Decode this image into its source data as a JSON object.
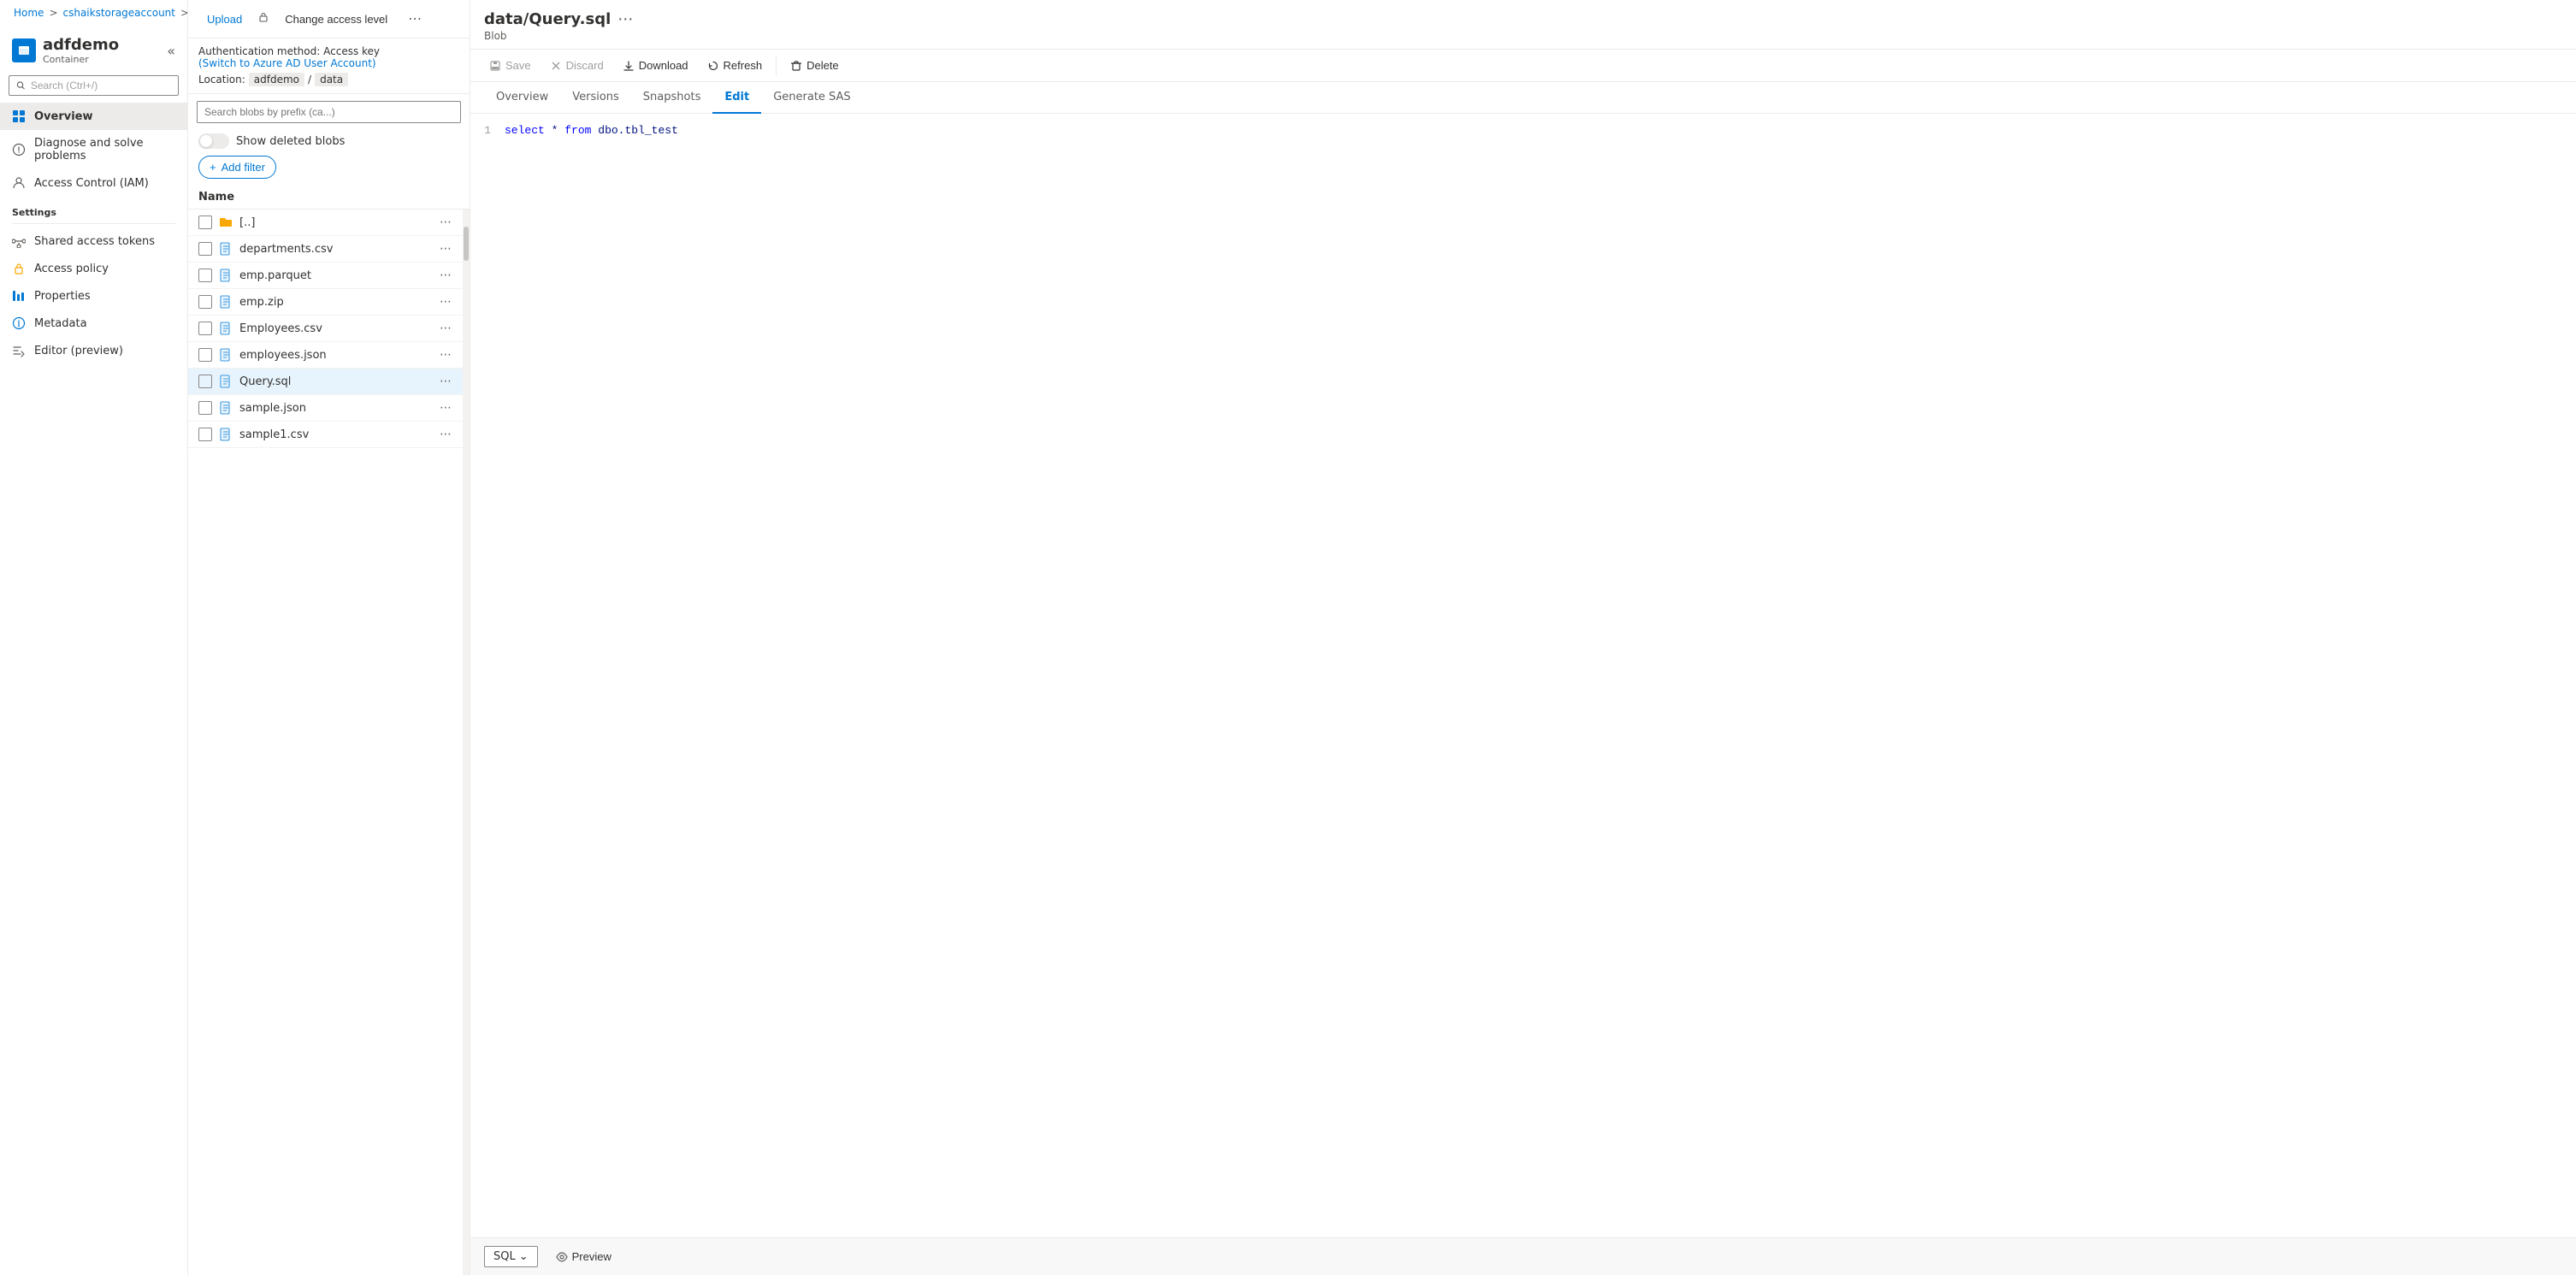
{
  "breadcrumb": {
    "home": "Home",
    "storage": "cshaikstorageaccount",
    "container": "adfdemo"
  },
  "sidebar": {
    "title": "adfdemo",
    "subtitle": "Container",
    "search_placeholder": "Search (Ctrl+/)",
    "collapse_title": "Collapse",
    "nav_items": [
      {
        "id": "overview",
        "label": "Overview",
        "active": true
      },
      {
        "id": "diagnose",
        "label": "Diagnose and solve problems",
        "active": false
      },
      {
        "id": "access-control",
        "label": "Access Control (IAM)",
        "active": false
      }
    ],
    "settings_label": "Settings",
    "settings_items": [
      {
        "id": "shared-access",
        "label": "Shared access tokens"
      },
      {
        "id": "access-policy",
        "label": "Access policy"
      },
      {
        "id": "properties",
        "label": "Properties"
      },
      {
        "id": "metadata",
        "label": "Metadata"
      },
      {
        "id": "editor",
        "label": "Editor (preview)"
      }
    ]
  },
  "file_panel": {
    "upload_label": "Upload",
    "change_access_label": "Change access level",
    "more_options": "...",
    "auth_label": "Authentication method:",
    "auth_value": "Access key",
    "auth_switch_link": "(Switch to Azure AD User Account)",
    "location_label": "Location:",
    "location_parts": [
      "adfdemo",
      "data"
    ],
    "search_placeholder": "Search blobs by prefix (ca...)",
    "show_deleted_label": "Show deleted blobs",
    "add_filter_label": "Add filter",
    "name_column": "Name",
    "files": [
      {
        "id": "folder-up",
        "name": "[..]",
        "type": "folder",
        "selected": false
      },
      {
        "id": "departments",
        "name": "departments.csv",
        "type": "file",
        "selected": false
      },
      {
        "id": "emp-parquet",
        "name": "emp.parquet",
        "type": "file",
        "selected": false
      },
      {
        "id": "emp-zip",
        "name": "emp.zip",
        "type": "file",
        "selected": false
      },
      {
        "id": "employees-csv",
        "name": "Employees.csv",
        "type": "file",
        "selected": false
      },
      {
        "id": "employees-json",
        "name": "employees.json",
        "type": "file",
        "selected": false
      },
      {
        "id": "query-sql",
        "name": "Query.sql",
        "type": "file",
        "selected": true
      },
      {
        "id": "sample-json",
        "name": "sample.json",
        "type": "file",
        "selected": false
      },
      {
        "id": "sample1-csv",
        "name": "sample1.csv",
        "type": "file",
        "selected": false
      }
    ]
  },
  "editor": {
    "title": "data/Query.sql",
    "subtitle": "Blob",
    "more": "...",
    "toolbar": {
      "save": "Save",
      "discard": "Discard",
      "download": "Download",
      "refresh": "Refresh",
      "delete": "Delete"
    },
    "tabs": [
      {
        "id": "overview",
        "label": "Overview",
        "active": false
      },
      {
        "id": "versions",
        "label": "Versions",
        "active": false
      },
      {
        "id": "snapshots",
        "label": "Snapshots",
        "active": false
      },
      {
        "id": "edit",
        "label": "Edit",
        "active": true
      },
      {
        "id": "generate-sas",
        "label": "Generate SAS",
        "active": false
      }
    ],
    "code": [
      {
        "line": 1,
        "content": "select * from dbo.tbl_test"
      }
    ],
    "language": "SQL",
    "preview_label": "Preview"
  }
}
